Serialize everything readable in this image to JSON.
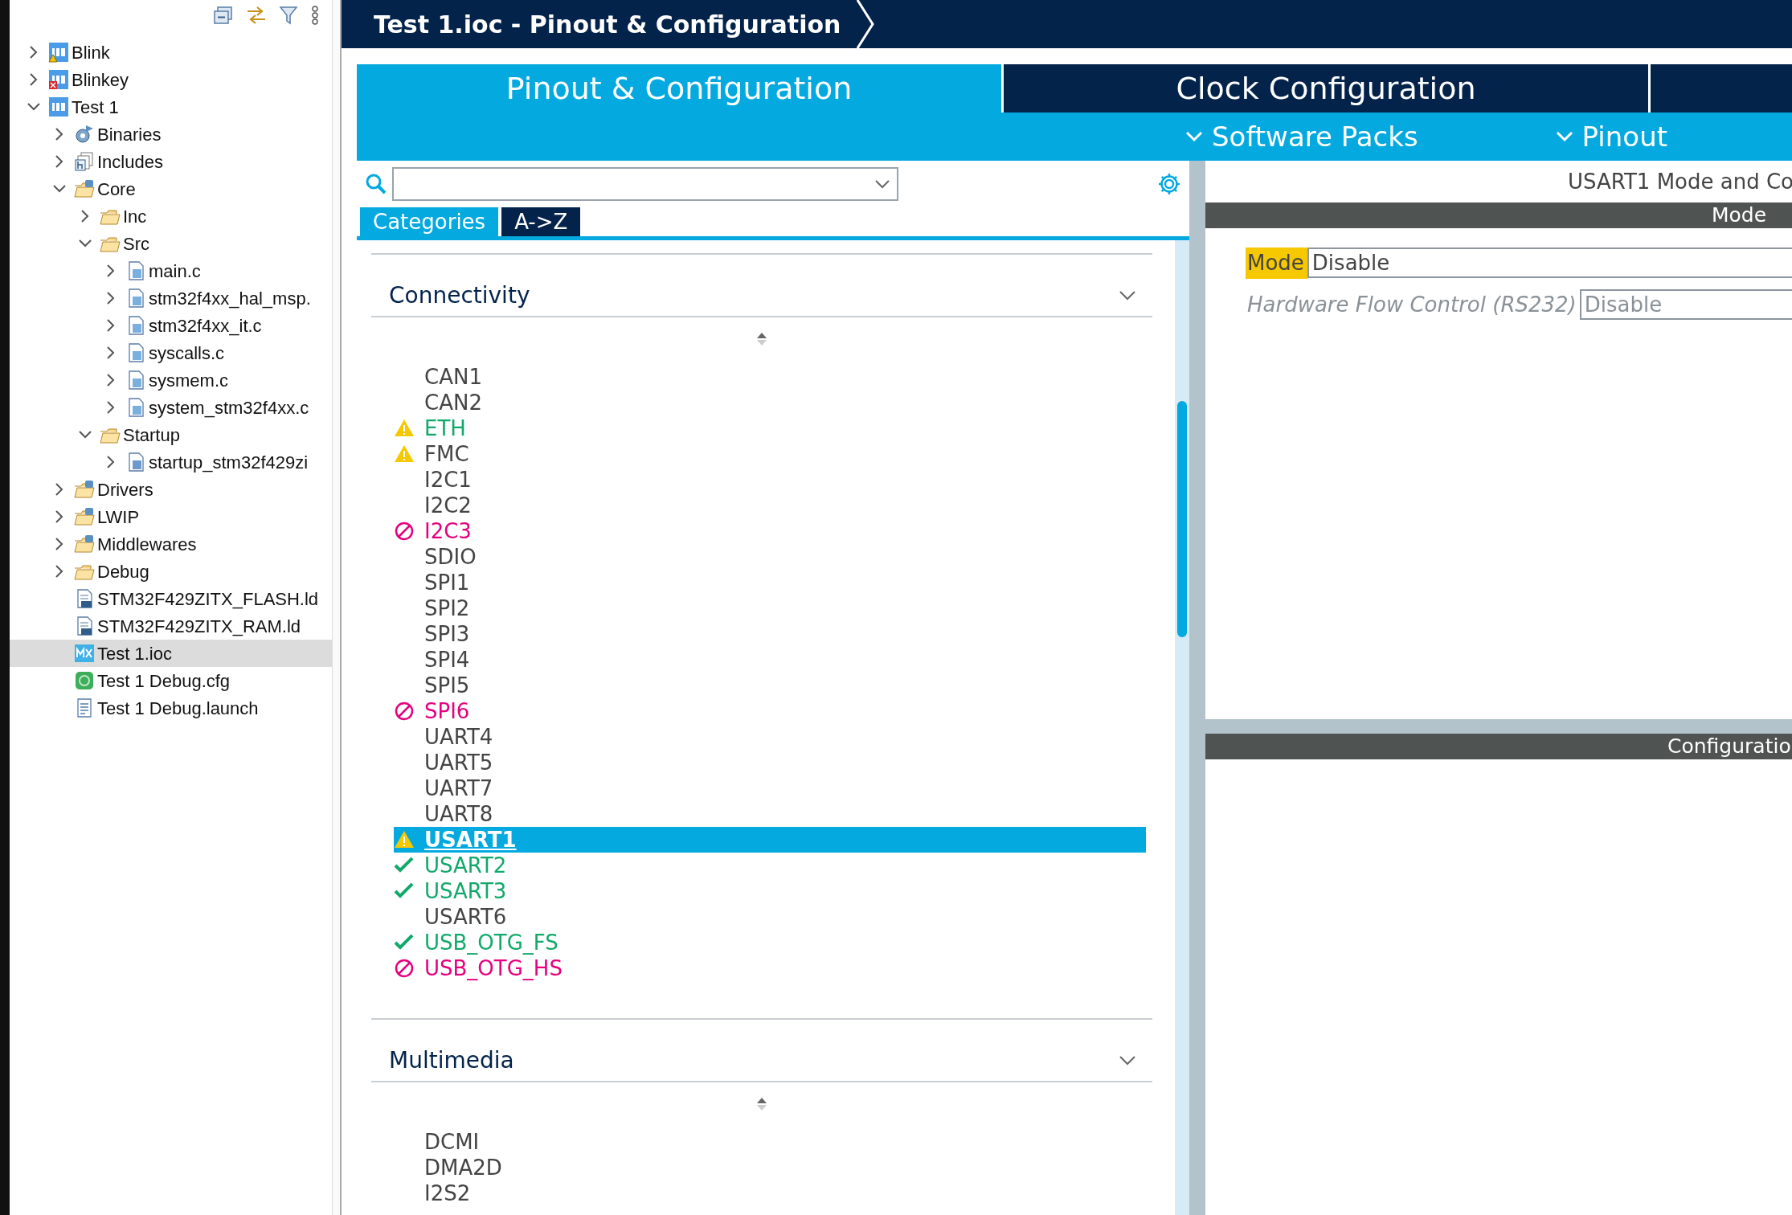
{
  "project_tree": [
    {
      "label": "Blink",
      "kind": "project",
      "has_warning": true,
      "expanded": false,
      "selected": false
    },
    {
      "label": "Blinkey",
      "kind": "project",
      "has_error": true,
      "expanded": false,
      "selected": false
    },
    {
      "label": "Test 1",
      "kind": "project",
      "expanded": true,
      "selected": false,
      "children": [
        {
          "label": "Binaries",
          "kind": "binaries",
          "expanded": false,
          "selected": false
        },
        {
          "label": "Includes",
          "kind": "includes",
          "expanded": false,
          "selected": false
        },
        {
          "label": "Core",
          "kind": "source-folder",
          "expanded": true,
          "selected": false,
          "children": [
            {
              "label": "Inc",
              "kind": "folder",
              "expanded": false,
              "selected": false
            },
            {
              "label": "Src",
              "kind": "folder",
              "expanded": true,
              "selected": false,
              "children": [
                {
                  "label": "main.c",
                  "kind": "c-file",
                  "expanded": false,
                  "selected": false
                },
                {
                  "label": "stm32f4xx_hal_msp.",
                  "kind": "c-file",
                  "expanded": false,
                  "selected": false
                },
                {
                  "label": "stm32f4xx_it.c",
                  "kind": "c-file",
                  "expanded": false,
                  "selected": false
                },
                {
                  "label": "syscalls.c",
                  "kind": "c-file",
                  "expanded": false,
                  "selected": false
                },
                {
                  "label": "sysmem.c",
                  "kind": "c-file",
                  "expanded": false,
                  "selected": false
                },
                {
                  "label": "system_stm32f4xx.c",
                  "kind": "c-file",
                  "expanded": false,
                  "selected": false
                }
              ]
            },
            {
              "label": "Startup",
              "kind": "folder",
              "expanded": true,
              "selected": false,
              "children": [
                {
                  "label": "startup_stm32f429zi",
                  "kind": "asm-file",
                  "expanded": false,
                  "selected": false
                }
              ]
            }
          ]
        },
        {
          "label": "Drivers",
          "kind": "source-folder",
          "expanded": false,
          "selected": false
        },
        {
          "label": "LWIP",
          "kind": "source-folder",
          "expanded": false,
          "selected": false
        },
        {
          "label": "Middlewares",
          "kind": "source-folder",
          "expanded": false,
          "selected": false
        },
        {
          "label": "Debug",
          "kind": "folder",
          "expanded": false,
          "selected": false
        },
        {
          "label": "STM32F429ZITX_FLASH.ld",
          "kind": "ld-file",
          "selected": false
        },
        {
          "label": "STM32F429ZITX_RAM.ld",
          "kind": "ld-file",
          "selected": false
        },
        {
          "label": "Test 1.ioc",
          "kind": "mx-file",
          "selected": true
        },
        {
          "label": "Test 1 Debug.cfg",
          "kind": "cfg-file",
          "selected": false
        },
        {
          "label": "Test 1 Debug.launch",
          "kind": "launch-file",
          "selected": false
        }
      ]
    }
  ],
  "editor_title": "Test 1.ioc - Pinout & Configuration",
  "tabs": [
    {
      "label": "Pinout & Configuration",
      "selected": true
    },
    {
      "label": "Clock Configuration",
      "selected": false
    },
    {
      "selected": false
    }
  ],
  "sub_menus": [
    {
      "label": "Software Packs"
    },
    {
      "label": "Pinout"
    }
  ],
  "view_tabs": [
    {
      "label": "Categories",
      "selected": true
    },
    {
      "label": "A->Z",
      "selected": false
    }
  ],
  "categories": [
    {
      "title": "Connectivity",
      "expanded": true,
      "items": [
        {
          "label": "CAN1",
          "configured": false,
          "selected": false
        },
        {
          "label": "CAN2",
          "configured": false,
          "selected": false
        },
        {
          "label": "ETH",
          "kind": "warning",
          "configured": true,
          "selected": false
        },
        {
          "label": "FMC",
          "kind": "warning",
          "configured": false,
          "selected": false
        },
        {
          "label": "I2C1",
          "configured": false,
          "selected": false
        },
        {
          "label": "I2C2",
          "configured": false,
          "selected": false
        },
        {
          "label": "I2C3",
          "kind": "blocked",
          "configured": false,
          "selected": false
        },
        {
          "label": "SDIO",
          "configured": false,
          "selected": false
        },
        {
          "label": "SPI1",
          "configured": false,
          "selected": false
        },
        {
          "label": "SPI2",
          "configured": false,
          "selected": false
        },
        {
          "label": "SPI3",
          "configured": false,
          "selected": false
        },
        {
          "label": "SPI4",
          "configured": false,
          "selected": false
        },
        {
          "label": "SPI5",
          "configured": false,
          "selected": false
        },
        {
          "label": "SPI6",
          "kind": "blocked",
          "configured": false,
          "selected": false
        },
        {
          "label": "UART4",
          "configured": false,
          "selected": false
        },
        {
          "label": "UART5",
          "configured": false,
          "selected": false
        },
        {
          "label": "UART7",
          "configured": false,
          "selected": false
        },
        {
          "label": "UART8",
          "configured": false,
          "selected": false
        },
        {
          "label": "USART1",
          "kind": "warning",
          "configured": false,
          "selected": true
        },
        {
          "label": "USART2",
          "kind": "ok",
          "configured": true,
          "selected": false
        },
        {
          "label": "USART3",
          "kind": "ok",
          "configured": true,
          "selected": false
        },
        {
          "label": "USART6",
          "configured": false,
          "selected": false
        },
        {
          "label": "USB_OTG_FS",
          "kind": "ok",
          "configured": true,
          "selected": false
        },
        {
          "label": "USB_OTG_HS",
          "kind": "blocked",
          "configured": false,
          "selected": false
        }
      ]
    },
    {
      "title": "Multimedia",
      "expanded": true,
      "items": [
        {
          "label": "DCMI",
          "configured": false,
          "selected": false
        },
        {
          "label": "DMA2D",
          "configured": false,
          "selected": false
        },
        {
          "label": "I2S2",
          "configured": false,
          "selected": false
        }
      ]
    }
  ],
  "mode_panel": {
    "title": "USART1 Mode and Co",
    "header": "Mode",
    "fields": [
      {
        "label": "Mode",
        "value": "Disable",
        "highlighted": true,
        "disabled": false
      },
      {
        "label": "Hardware Flow Control (RS232)",
        "value": "Disable",
        "highlighted": false,
        "disabled": true
      }
    ]
  },
  "configuration_header": "Configuratio"
}
